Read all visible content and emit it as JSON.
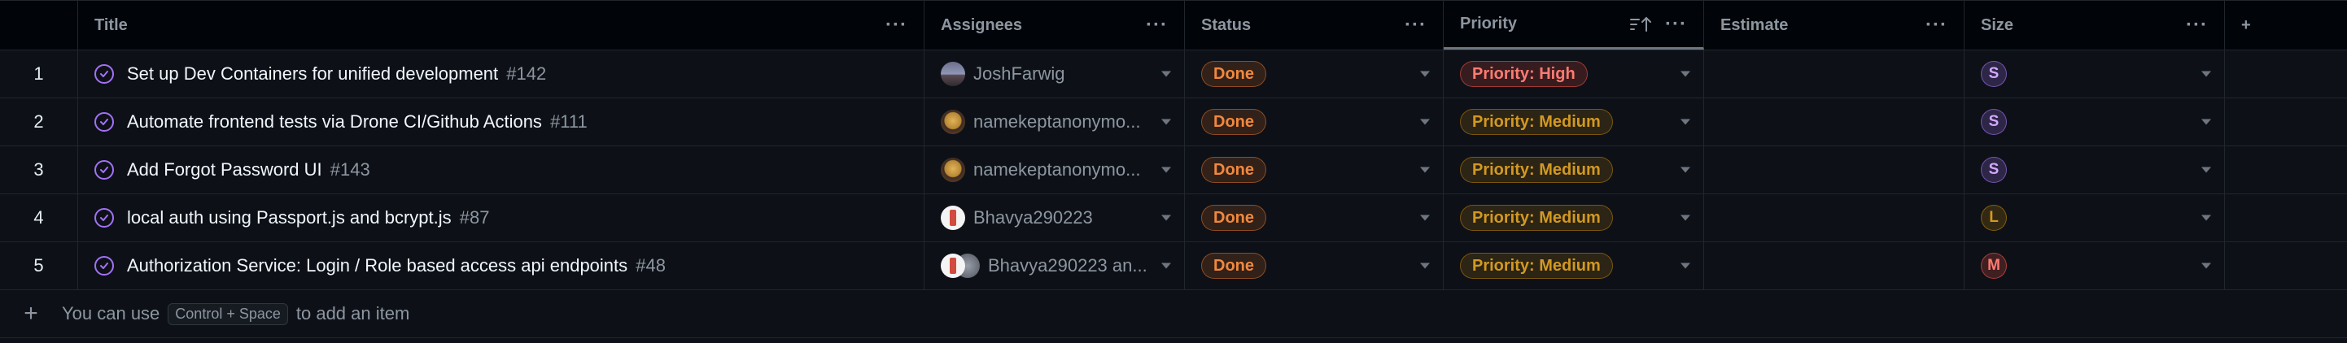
{
  "columns": {
    "title": "Title",
    "assignees": "Assignees",
    "status": "Status",
    "priority": "Priority",
    "estimate": "Estimate",
    "size": "Size"
  },
  "icons": {
    "column_menu": "more-horizontal-icon",
    "sort": "sort-ascending-icon",
    "add_column": "plus-icon",
    "issue_state": "issue-closed-check-icon",
    "dropdown": "chevron-down-icon"
  },
  "rows": [
    {
      "index": "1",
      "title": "Set up Dev Containers for unified development",
      "number": "#142",
      "assignees": "JoshFarwig",
      "status": "Done",
      "priority": "Priority: High",
      "estimate": "",
      "size": "S"
    },
    {
      "index": "2",
      "title": "Automate frontend tests via Drone CI/Github Actions",
      "number": "#111",
      "assignees": "namekeptanonymo...",
      "status": "Done",
      "priority": "Priority: Medium",
      "estimate": "",
      "size": "S"
    },
    {
      "index": "3",
      "title": "Add Forgot Password UI",
      "number": "#143",
      "assignees": "namekeptanonymo...",
      "status": "Done",
      "priority": "Priority: Medium",
      "estimate": "",
      "size": "S"
    },
    {
      "index": "4",
      "title": "local auth using Passport.js and bcrypt.js",
      "number": "#87",
      "assignees": "Bhavya290223",
      "status": "Done",
      "priority": "Priority: Medium",
      "estimate": "",
      "size": "L"
    },
    {
      "index": "5",
      "title": "Authorization Service: Login / Role based access api endpoints",
      "number": "#48",
      "assignees": "Bhavya290223 an...",
      "status": "Done",
      "priority": "Priority: Medium",
      "estimate": "",
      "size": "M"
    }
  ],
  "add_item": {
    "prefix": "You can use",
    "shortcut": "Control + Space",
    "suffix": "to add an item"
  },
  "colors": {
    "background": "#0d1117",
    "status_done": "#f0883e",
    "priority_high": "#ff7b72",
    "priority_medium": "#d29922",
    "size_s": "#d2a8ff",
    "size_l": "#d29922",
    "size_m": "#ff7b72",
    "closed_issue": "#a371f7"
  }
}
